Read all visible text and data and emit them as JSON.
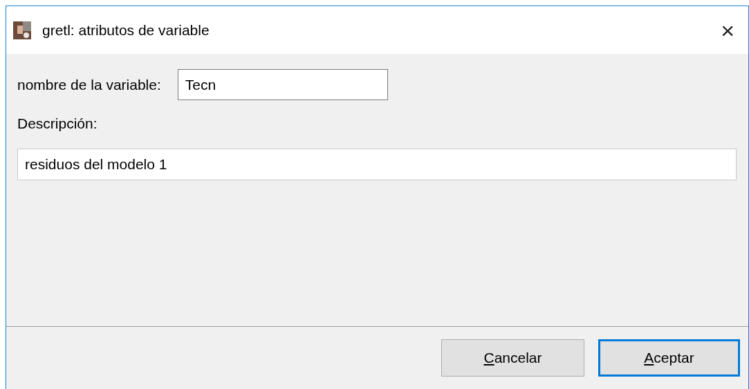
{
  "window": {
    "title": "gretl: atributos de variable",
    "close": "×"
  },
  "fields": [
    {
      "label": "nombre de la variable:",
      "value": "Tecn",
      "focused": true
    },
    {
      "label": "Descripción:",
      "value": "residuos del modelo 1",
      "focused": false
    }
  ],
  "buttons": [
    {
      "label": "Cancelar",
      "default": false,
      "mnemonic_underlined": true
    },
    {
      "label": "Aceptar",
      "default": true,
      "mnemonic_underlined": true
    }
  ]
}
